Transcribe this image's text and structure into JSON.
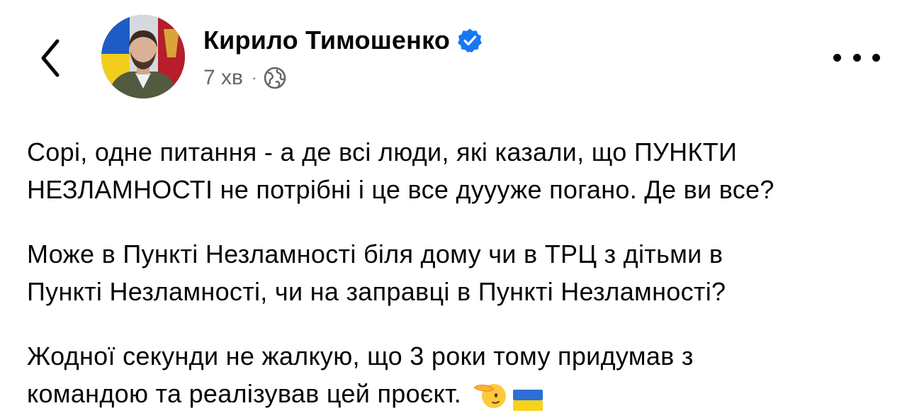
{
  "header": {
    "back_icon": "chevron-left-icon",
    "author_name": "Кирило Тимошенко",
    "verified_icon": "verified-badge-icon",
    "post_time": "7 хв",
    "separator": "·",
    "privacy_icon": "globe-icon",
    "more_icon": "more-horizontal-icon"
  },
  "post": {
    "paragraphs": [
      "Сорі, одне питання - а де всі люди, які казали, що ПУНКТИ\nНЕЗЛАМНОСТІ не потрібні і це все дуууже погано. Де ви все?",
      "Може в Пункті Незламності біля дому чи в ТРЦ з дітьми в\nПункті Незламності, чи на заправці в Пункті Незламності?",
      "Жодної секунди не жалкую, що 3 роки тому придумав з\nкомандою та реалізував цей проєкт."
    ],
    "emojis": [
      "saluting-face-emoji",
      "ukraine-flag-emoji"
    ]
  },
  "colors": {
    "text": "#050505",
    "secondary": "#65676b",
    "verified": "#1877f2",
    "flag_blue": "#2d6fd6",
    "flag_yellow": "#f7d21d"
  }
}
